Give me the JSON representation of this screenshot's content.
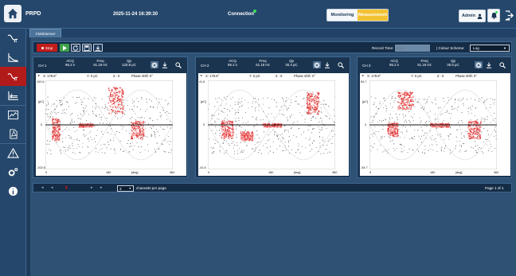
{
  "header": {
    "app_title": "PRPD",
    "datetime": "2025-11-24 16:39:30",
    "connection": "Connection",
    "monitoring_label": "Monitoring",
    "measurement_label": "Measurement",
    "admin_label": "Admin"
  },
  "sidebar": {
    "items": [
      {
        "icon": "pd-signal-icon"
      },
      {
        "icon": "waveform-icon"
      },
      {
        "icon": "prpd-icon",
        "active": true
      },
      {
        "icon": "chart-icon"
      },
      {
        "icon": "trend-icon"
      },
      {
        "icon": "pdf-icon"
      },
      {
        "icon": "alarm-icon"
      },
      {
        "icon": "settings-icon"
      },
      {
        "icon": "info-icon"
      }
    ]
  },
  "tab": {
    "label": "CMobserver"
  },
  "toolbar": {
    "stop_label": "Stop",
    "record_time_label": "Record Time:",
    "record_time_placeholder": "120s",
    "colour_scheme_label": "| Colour Scheme:",
    "colour_scheme_value": "Log"
  },
  "channels": [
    {
      "name": "CH 1",
      "acq_label": "ACQ",
      "acq_value": "95.2 s",
      "freq_label": "Freq",
      "freq_value": "51.18 Hz",
      "qp_label": "Qp",
      "qp_value": "120.8 pC",
      "x_readout": "X: 178.8°",
      "y_readout": "Y: 0 pC",
      "z_readout": "Z : 0",
      "phase_shift": "Phase shift: 0°",
      "y_top": "102.6",
      "y_unit": "[pC]",
      "y_mid": "0",
      "y_bottom": "-102.6",
      "x_min": "0",
      "x_mid": "180",
      "x_unit": "[deg]",
      "x_max": "360"
    },
    {
      "name": "CH 2",
      "acq_label": "ACQ",
      "acq_value": "95.2 s",
      "freq_label": "Freq",
      "freq_value": "51.18 Hz",
      "qp_label": "Qp",
      "qp_value": "30.4 pC",
      "x_readout": "X: 178.8°",
      "y_readout": "Y: 0 pC",
      "z_readout": "Z : 0",
      "phase_shift": "Phase shift: 0°",
      "y_top": "41.6",
      "y_unit": "[pC]",
      "y_mid": "0",
      "y_bottom": "-41.6",
      "x_min": "0",
      "x_mid": "180",
      "x_unit": "[deg]",
      "x_max": "360"
    },
    {
      "name": "CH 3",
      "acq_label": "ACQ",
      "acq_value": "95.2 s",
      "freq_label": "Freq",
      "freq_value": "51.18 Hz",
      "qp_label": "Qp",
      "qp_value": "35.5 pC",
      "x_readout": "X: 178.8°",
      "y_readout": "Y: 0 pC",
      "z_readout": "Z : 0",
      "phase_shift": "Phase shift: 0°",
      "y_top": "54.7",
      "y_unit": "[pC]",
      "y_mid": "0",
      "y_bottom": "-54.7",
      "x_min": "0",
      "x_mid": "180",
      "x_unit": "[deg]",
      "x_max": "360"
    }
  ],
  "pager": {
    "per_page_value": "3",
    "per_page_label": "channels per page",
    "page_info": "Page 1 of 1"
  },
  "colors": {
    "accent_measurement": "#f2c232",
    "stop_red": "#c41d1d",
    "active_nav": "#b31b1b",
    "play_green": "#3fa34d"
  }
}
